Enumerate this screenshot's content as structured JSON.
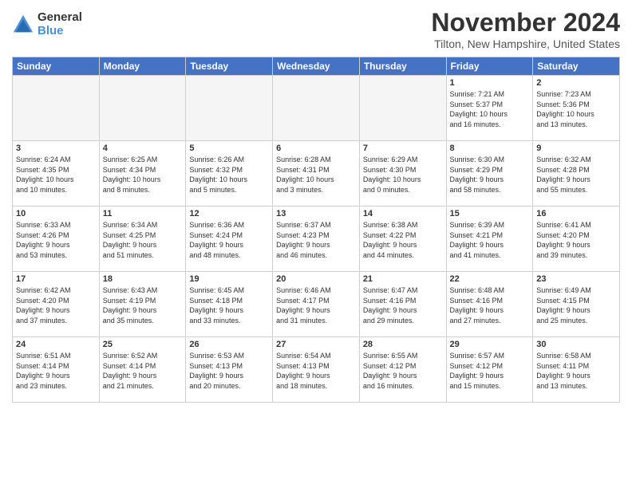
{
  "logo": {
    "general": "General",
    "blue": "Blue"
  },
  "title": "November 2024",
  "location": "Tilton, New Hampshire, United States",
  "headers": [
    "Sunday",
    "Monday",
    "Tuesday",
    "Wednesday",
    "Thursday",
    "Friday",
    "Saturday"
  ],
  "weeks": [
    [
      {
        "day": "",
        "info": ""
      },
      {
        "day": "",
        "info": ""
      },
      {
        "day": "",
        "info": ""
      },
      {
        "day": "",
        "info": ""
      },
      {
        "day": "",
        "info": ""
      },
      {
        "day": "1",
        "info": "Sunrise: 7:21 AM\nSunset: 5:37 PM\nDaylight: 10 hours\nand 16 minutes."
      },
      {
        "day": "2",
        "info": "Sunrise: 7:23 AM\nSunset: 5:36 PM\nDaylight: 10 hours\nand 13 minutes."
      }
    ],
    [
      {
        "day": "3",
        "info": "Sunrise: 6:24 AM\nSunset: 4:35 PM\nDaylight: 10 hours\nand 10 minutes."
      },
      {
        "day": "4",
        "info": "Sunrise: 6:25 AM\nSunset: 4:34 PM\nDaylight: 10 hours\nand 8 minutes."
      },
      {
        "day": "5",
        "info": "Sunrise: 6:26 AM\nSunset: 4:32 PM\nDaylight: 10 hours\nand 5 minutes."
      },
      {
        "day": "6",
        "info": "Sunrise: 6:28 AM\nSunset: 4:31 PM\nDaylight: 10 hours\nand 3 minutes."
      },
      {
        "day": "7",
        "info": "Sunrise: 6:29 AM\nSunset: 4:30 PM\nDaylight: 10 hours\nand 0 minutes."
      },
      {
        "day": "8",
        "info": "Sunrise: 6:30 AM\nSunset: 4:29 PM\nDaylight: 9 hours\nand 58 minutes."
      },
      {
        "day": "9",
        "info": "Sunrise: 6:32 AM\nSunset: 4:28 PM\nDaylight: 9 hours\nand 55 minutes."
      }
    ],
    [
      {
        "day": "10",
        "info": "Sunrise: 6:33 AM\nSunset: 4:26 PM\nDaylight: 9 hours\nand 53 minutes."
      },
      {
        "day": "11",
        "info": "Sunrise: 6:34 AM\nSunset: 4:25 PM\nDaylight: 9 hours\nand 51 minutes."
      },
      {
        "day": "12",
        "info": "Sunrise: 6:36 AM\nSunset: 4:24 PM\nDaylight: 9 hours\nand 48 minutes."
      },
      {
        "day": "13",
        "info": "Sunrise: 6:37 AM\nSunset: 4:23 PM\nDaylight: 9 hours\nand 46 minutes."
      },
      {
        "day": "14",
        "info": "Sunrise: 6:38 AM\nSunset: 4:22 PM\nDaylight: 9 hours\nand 44 minutes."
      },
      {
        "day": "15",
        "info": "Sunrise: 6:39 AM\nSunset: 4:21 PM\nDaylight: 9 hours\nand 41 minutes."
      },
      {
        "day": "16",
        "info": "Sunrise: 6:41 AM\nSunset: 4:20 PM\nDaylight: 9 hours\nand 39 minutes."
      }
    ],
    [
      {
        "day": "17",
        "info": "Sunrise: 6:42 AM\nSunset: 4:20 PM\nDaylight: 9 hours\nand 37 minutes."
      },
      {
        "day": "18",
        "info": "Sunrise: 6:43 AM\nSunset: 4:19 PM\nDaylight: 9 hours\nand 35 minutes."
      },
      {
        "day": "19",
        "info": "Sunrise: 6:45 AM\nSunset: 4:18 PM\nDaylight: 9 hours\nand 33 minutes."
      },
      {
        "day": "20",
        "info": "Sunrise: 6:46 AM\nSunset: 4:17 PM\nDaylight: 9 hours\nand 31 minutes."
      },
      {
        "day": "21",
        "info": "Sunrise: 6:47 AM\nSunset: 4:16 PM\nDaylight: 9 hours\nand 29 minutes."
      },
      {
        "day": "22",
        "info": "Sunrise: 6:48 AM\nSunset: 4:16 PM\nDaylight: 9 hours\nand 27 minutes."
      },
      {
        "day": "23",
        "info": "Sunrise: 6:49 AM\nSunset: 4:15 PM\nDaylight: 9 hours\nand 25 minutes."
      }
    ],
    [
      {
        "day": "24",
        "info": "Sunrise: 6:51 AM\nSunset: 4:14 PM\nDaylight: 9 hours\nand 23 minutes."
      },
      {
        "day": "25",
        "info": "Sunrise: 6:52 AM\nSunset: 4:14 PM\nDaylight: 9 hours\nand 21 minutes."
      },
      {
        "day": "26",
        "info": "Sunrise: 6:53 AM\nSunset: 4:13 PM\nDaylight: 9 hours\nand 20 minutes."
      },
      {
        "day": "27",
        "info": "Sunrise: 6:54 AM\nSunset: 4:13 PM\nDaylight: 9 hours\nand 18 minutes."
      },
      {
        "day": "28",
        "info": "Sunrise: 6:55 AM\nSunset: 4:12 PM\nDaylight: 9 hours\nand 16 minutes."
      },
      {
        "day": "29",
        "info": "Sunrise: 6:57 AM\nSunset: 4:12 PM\nDaylight: 9 hours\nand 15 minutes."
      },
      {
        "day": "30",
        "info": "Sunrise: 6:58 AM\nSunset: 4:11 PM\nDaylight: 9 hours\nand 13 minutes."
      }
    ]
  ]
}
